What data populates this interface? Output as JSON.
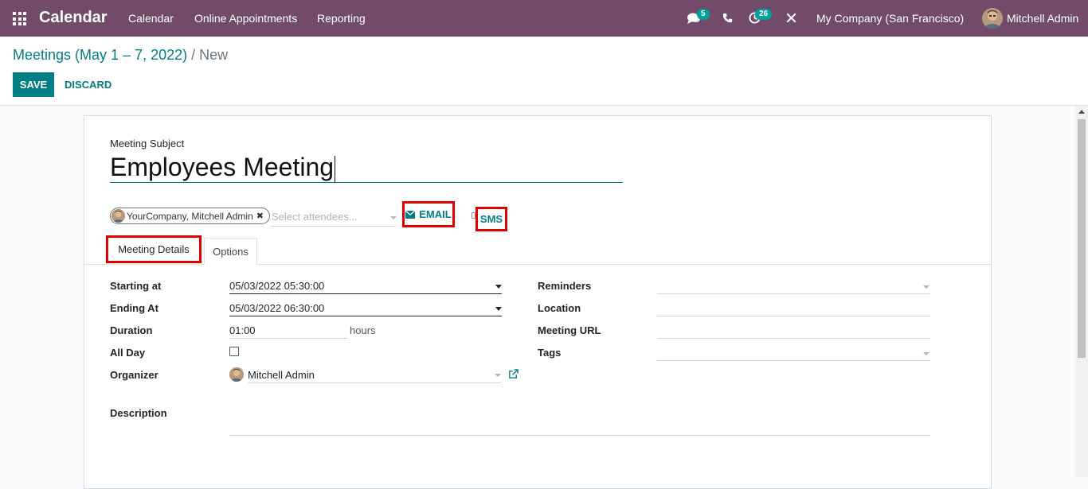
{
  "navbar": {
    "app_name": "Calendar",
    "menu": [
      "Calendar",
      "Online Appointments",
      "Reporting"
    ],
    "messages_count": "5",
    "activities_count": "26",
    "company": "My Company (San Francisco)",
    "user": "Mitchell Admin",
    "colors": {
      "bar": "#714b67",
      "badge": "#00a09d"
    }
  },
  "control_panel": {
    "breadcrumb_parent": "Meetings (May 1 – 7, 2022)",
    "breadcrumb_separator": "/",
    "breadcrumb_current": "New",
    "save_label": "SAVE",
    "discard_label": "DISCARD"
  },
  "form": {
    "subject_label": "Meeting Subject",
    "subject_value": "Employees Meeting",
    "attendee_tag": "YourCompany, Mitchell Admin",
    "attendees_placeholder": "Select attendees...",
    "email_label": "EMAIL",
    "sms_label": "SMS",
    "tabs": [
      "Meeting Details",
      "Options"
    ],
    "left_fields": {
      "starting_at_label": "Starting at",
      "starting_at_value": "05/03/2022 05:30:00",
      "ending_at_label": "Ending At",
      "ending_at_value": "05/03/2022 06:30:00",
      "duration_label": "Duration",
      "duration_value": "01:00",
      "duration_unit": "hours",
      "all_day_label": "All Day",
      "all_day_checked": false,
      "organizer_label": "Organizer",
      "organizer_value": "Mitchell Admin"
    },
    "right_fields": {
      "reminders_label": "Reminders",
      "location_label": "Location",
      "meeting_url_label": "Meeting URL",
      "tags_label": "Tags"
    },
    "description_label": "Description",
    "accent_color": "#017e84",
    "highlight_color": "#e00000"
  }
}
